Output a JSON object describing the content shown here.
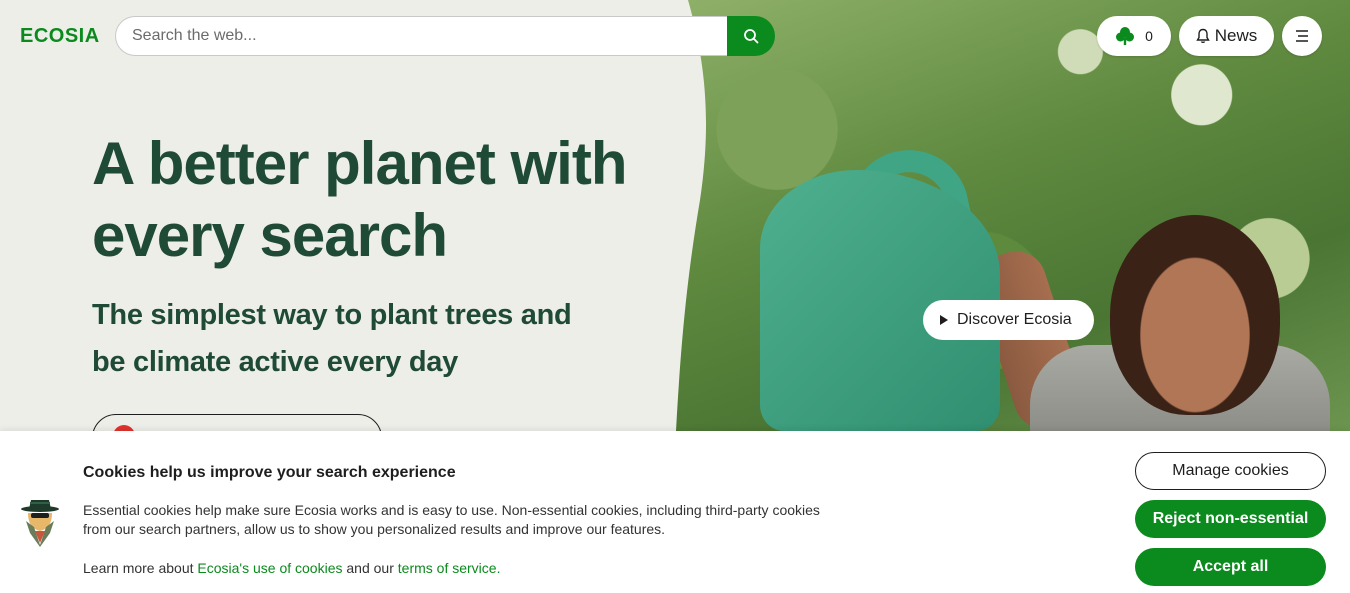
{
  "header": {
    "logo": "ECOSIA",
    "search": {
      "placeholder": "Search the web...",
      "value": ""
    },
    "tree_count": "0",
    "news_label": "News"
  },
  "hero": {
    "title": "A better planet with every search",
    "subtitle": "The simplest way to plant trees and be climate active every day",
    "discover_label": "Discover Ecosia"
  },
  "cookie_banner": {
    "title": "Cookies help us improve your search experience",
    "body": "Essential cookies help make sure Ecosia works and is easy to use. Non-essential cookies, including third-party cookies from our search partners, allow us to show you personalized results and improve our features.",
    "learn_prefix": "Learn more about ",
    "cookies_link": "Ecosia's use of cookies",
    "learn_mid": " and our ",
    "terms_link": "terms of service.",
    "manage_label": "Manage cookies",
    "reject_label": "Reject non-essential",
    "accept_label": "Accept all"
  },
  "colors": {
    "brand_green": "#0b8a1d",
    "hero_text": "#1f4a35",
    "background": "#eeeee9"
  },
  "icons": {
    "search": "search-icon",
    "tree": "tree-icon",
    "bell": "bell-icon",
    "menu": "menu-icon",
    "play": "play-icon",
    "cookie_mascot": "cookie-mascot-icon"
  }
}
